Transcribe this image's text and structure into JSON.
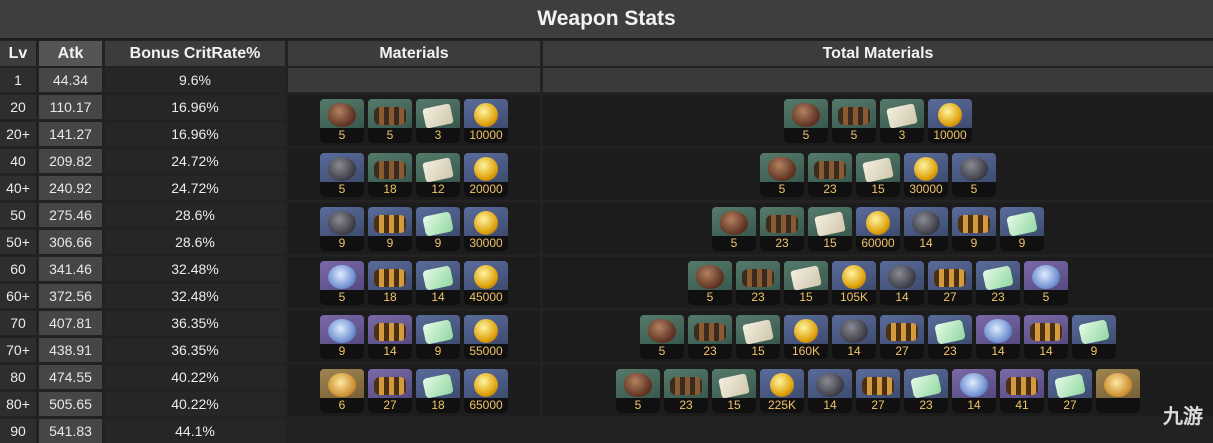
{
  "title": "Weapon Stats",
  "headers": {
    "lv": "Lv",
    "atk": "Atk",
    "crit": "Bonus CritRate%",
    "materials": "Materials",
    "total": "Total Materials"
  },
  "rows": [
    {
      "lv": "1",
      "atk": "44.34",
      "crit": "9.6%"
    },
    {
      "lv": "20",
      "atk": "110.17",
      "crit": "16.96%"
    },
    {
      "lv": "20+",
      "atk": "141.27",
      "crit": "16.96%"
    },
    {
      "lv": "40",
      "atk": "209.82",
      "crit": "24.72%"
    },
    {
      "lv": "40+",
      "atk": "240.92",
      "crit": "24.72%"
    },
    {
      "lv": "50",
      "atk": "275.46",
      "crit": "28.6%"
    },
    {
      "lv": "50+",
      "atk": "306.66",
      "crit": "28.6%"
    },
    {
      "lv": "60",
      "atk": "341.46",
      "crit": "32.48%"
    },
    {
      "lv": "60+",
      "atk": "372.56",
      "crit": "32.48%"
    },
    {
      "lv": "70",
      "atk": "407.81",
      "crit": "36.35%"
    },
    {
      "lv": "70+",
      "atk": "438.91",
      "crit": "36.35%"
    },
    {
      "lv": "80",
      "atk": "474.55",
      "crit": "40.22%"
    },
    {
      "lv": "80+",
      "atk": "505.65",
      "crit": "40.22%"
    },
    {
      "lv": "90",
      "atk": "541.83",
      "crit": "44.1%"
    }
  ],
  "materials": [
    [
      {
        "icon": "brown-ore-icon",
        "tier": "green",
        "count": "5"
      },
      {
        "icon": "dark-bolt-icon",
        "tier": "green",
        "count": "5"
      },
      {
        "icon": "white-scroll-icon",
        "tier": "green",
        "count": "3"
      },
      {
        "icon": "coin-icon",
        "tier": "blue",
        "count": "10000"
      }
    ],
    [
      {
        "icon": "grey-ore-icon",
        "tier": "blue",
        "count": "5"
      },
      {
        "icon": "dark-bolt-icon",
        "tier": "green",
        "count": "18"
      },
      {
        "icon": "white-scroll-icon",
        "tier": "green",
        "count": "12"
      },
      {
        "icon": "coin-icon",
        "tier": "blue",
        "count": "20000"
      }
    ],
    [
      {
        "icon": "grey-ore-icon",
        "tier": "blue",
        "count": "9"
      },
      {
        "icon": "bronze-bolt-icon",
        "tier": "blue",
        "count": "9"
      },
      {
        "icon": "green-scroll-icon",
        "tier": "blue",
        "count": "9"
      },
      {
        "icon": "coin-icon",
        "tier": "blue",
        "count": "30000"
      }
    ],
    [
      {
        "icon": "blue-disc-icon",
        "tier": "purple",
        "count": "5"
      },
      {
        "icon": "bronze-bolt-icon",
        "tier": "blue",
        "count": "18"
      },
      {
        "icon": "green-scroll-icon",
        "tier": "blue",
        "count": "14"
      },
      {
        "icon": "coin-icon",
        "tier": "blue",
        "count": "45000"
      }
    ],
    [
      {
        "icon": "blue-disc-icon",
        "tier": "purple",
        "count": "9"
      },
      {
        "icon": "gold-bolt-icon",
        "tier": "purple",
        "count": "14"
      },
      {
        "icon": "green-orb-icon",
        "tier": "blue",
        "count": "9"
      },
      {
        "icon": "coin-icon",
        "tier": "blue",
        "count": "55000"
      }
    ],
    [
      {
        "icon": "gold-disc-icon",
        "tier": "gold",
        "count": "6"
      },
      {
        "icon": "gold-bolt-icon",
        "tier": "purple",
        "count": "27"
      },
      {
        "icon": "green-orb-icon",
        "tier": "blue",
        "count": "18"
      },
      {
        "icon": "coin-icon",
        "tier": "blue",
        "count": "65000"
      }
    ]
  ],
  "totals": [
    [
      {
        "icon": "brown-ore-icon",
        "tier": "green",
        "count": "5"
      },
      {
        "icon": "dark-bolt-icon",
        "tier": "green",
        "count": "5"
      },
      {
        "icon": "white-scroll-icon",
        "tier": "green",
        "count": "3"
      },
      {
        "icon": "coin-icon",
        "tier": "blue",
        "count": "10000"
      }
    ],
    [
      {
        "icon": "brown-ore-icon",
        "tier": "green",
        "count": "5"
      },
      {
        "icon": "dark-bolt-icon",
        "tier": "green",
        "count": "23"
      },
      {
        "icon": "white-scroll-icon",
        "tier": "green",
        "count": "15"
      },
      {
        "icon": "coin-icon",
        "tier": "blue",
        "count": "30000"
      },
      {
        "icon": "grey-ore-icon",
        "tier": "blue",
        "count": "5"
      }
    ],
    [
      {
        "icon": "brown-ore-icon",
        "tier": "green",
        "count": "5"
      },
      {
        "icon": "dark-bolt-icon",
        "tier": "green",
        "count": "23"
      },
      {
        "icon": "white-scroll-icon",
        "tier": "green",
        "count": "15"
      },
      {
        "icon": "coin-icon",
        "tier": "blue",
        "count": "60000"
      },
      {
        "icon": "grey-ore-icon",
        "tier": "blue",
        "count": "14"
      },
      {
        "icon": "bronze-bolt-icon",
        "tier": "blue",
        "count": "9"
      },
      {
        "icon": "green-scroll-icon",
        "tier": "blue",
        "count": "9"
      }
    ],
    [
      {
        "icon": "brown-ore-icon",
        "tier": "green",
        "count": "5"
      },
      {
        "icon": "dark-bolt-icon",
        "tier": "green",
        "count": "23"
      },
      {
        "icon": "white-scroll-icon",
        "tier": "green",
        "count": "15"
      },
      {
        "icon": "coin-icon",
        "tier": "blue",
        "count": "105K"
      },
      {
        "icon": "grey-ore-icon",
        "tier": "blue",
        "count": "14"
      },
      {
        "icon": "bronze-bolt-icon",
        "tier": "blue",
        "count": "27"
      },
      {
        "icon": "green-scroll-icon",
        "tier": "blue",
        "count": "23"
      },
      {
        "icon": "blue-disc-icon",
        "tier": "purple",
        "count": "5"
      }
    ],
    [
      {
        "icon": "brown-ore-icon",
        "tier": "green",
        "count": "5"
      },
      {
        "icon": "dark-bolt-icon",
        "tier": "green",
        "count": "23"
      },
      {
        "icon": "white-scroll-icon",
        "tier": "green",
        "count": "15"
      },
      {
        "icon": "coin-icon",
        "tier": "blue",
        "count": "160K"
      },
      {
        "icon": "grey-ore-icon",
        "tier": "blue",
        "count": "14"
      },
      {
        "icon": "bronze-bolt-icon",
        "tier": "blue",
        "count": "27"
      },
      {
        "icon": "green-scroll-icon",
        "tier": "blue",
        "count": "23"
      },
      {
        "icon": "blue-disc-icon",
        "tier": "purple",
        "count": "14"
      },
      {
        "icon": "gold-bolt-icon",
        "tier": "purple",
        "count": "14"
      },
      {
        "icon": "green-orb-icon",
        "tier": "blue",
        "count": "9"
      }
    ],
    [
      {
        "icon": "brown-ore-icon",
        "tier": "green",
        "count": "5"
      },
      {
        "icon": "dark-bolt-icon",
        "tier": "green",
        "count": "23"
      },
      {
        "icon": "white-scroll-icon",
        "tier": "green",
        "count": "15"
      },
      {
        "icon": "coin-icon",
        "tier": "blue",
        "count": "225K"
      },
      {
        "icon": "grey-ore-icon",
        "tier": "blue",
        "count": "14"
      },
      {
        "icon": "bronze-bolt-icon",
        "tier": "blue",
        "count": "27"
      },
      {
        "icon": "green-scroll-icon",
        "tier": "blue",
        "count": "23"
      },
      {
        "icon": "blue-disc-icon",
        "tier": "purple",
        "count": "14"
      },
      {
        "icon": "gold-bolt-icon",
        "tier": "purple",
        "count": "41"
      },
      {
        "icon": "green-orb-icon",
        "tier": "blue",
        "count": "27"
      },
      {
        "icon": "gold-disc-icon",
        "tier": "gold",
        "count": ""
      }
    ]
  ],
  "watermark": "九游",
  "colors": {
    "background": "#222222",
    "header": "#3c3c3c",
    "count_text": "#f0c46a"
  }
}
